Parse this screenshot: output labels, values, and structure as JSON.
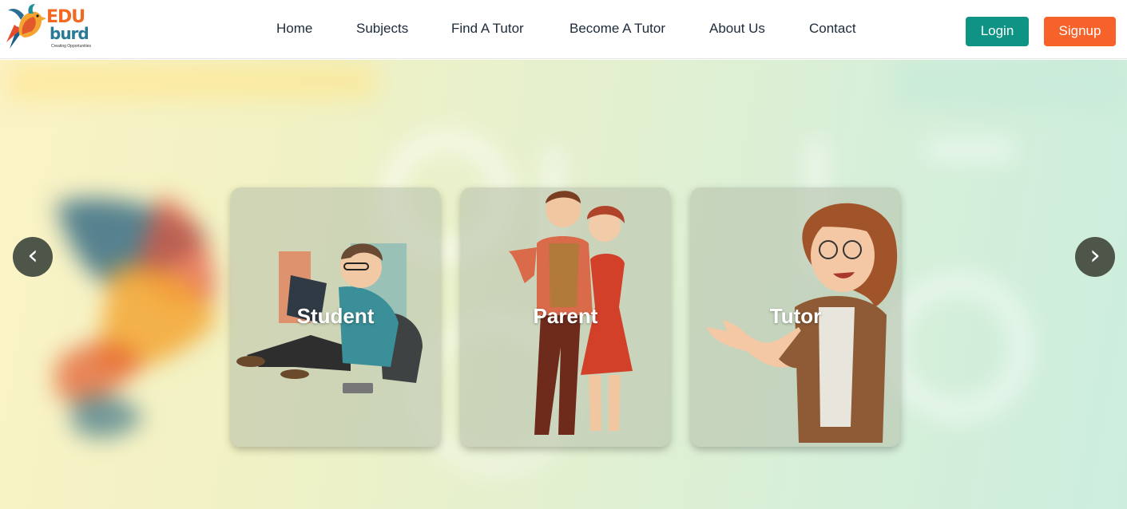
{
  "brand": {
    "name_top": "EDU",
    "name_bottom": "burd",
    "tagline": "Creating Opportunities"
  },
  "nav": {
    "items": [
      {
        "label": "Home",
        "icon": null
      },
      {
        "label": "Subjects",
        "icon": null
      },
      {
        "label": "Find A Tutor",
        "icon": null
      },
      {
        "label": "Become A Tutor",
        "icon": null
      },
      {
        "label": "About Us",
        "icon": null
      },
      {
        "label": "Contact",
        "icon": null
      }
    ],
    "login_label": "Login",
    "signup_label": "Signup"
  },
  "hero": {
    "prev_arrow": "‹",
    "next_arrow": "›",
    "cards": [
      {
        "label": "Student",
        "icon": "student-illustration"
      },
      {
        "label": "Parent",
        "icon": "parents-illustration"
      },
      {
        "label": "Tutor",
        "icon": "tutor-illustration"
      }
    ]
  },
  "colors": {
    "login": "#0e9384",
    "signup": "#f7622a",
    "nav_text": "#1d2b3a",
    "arrow_bg": "#4e5549"
  }
}
